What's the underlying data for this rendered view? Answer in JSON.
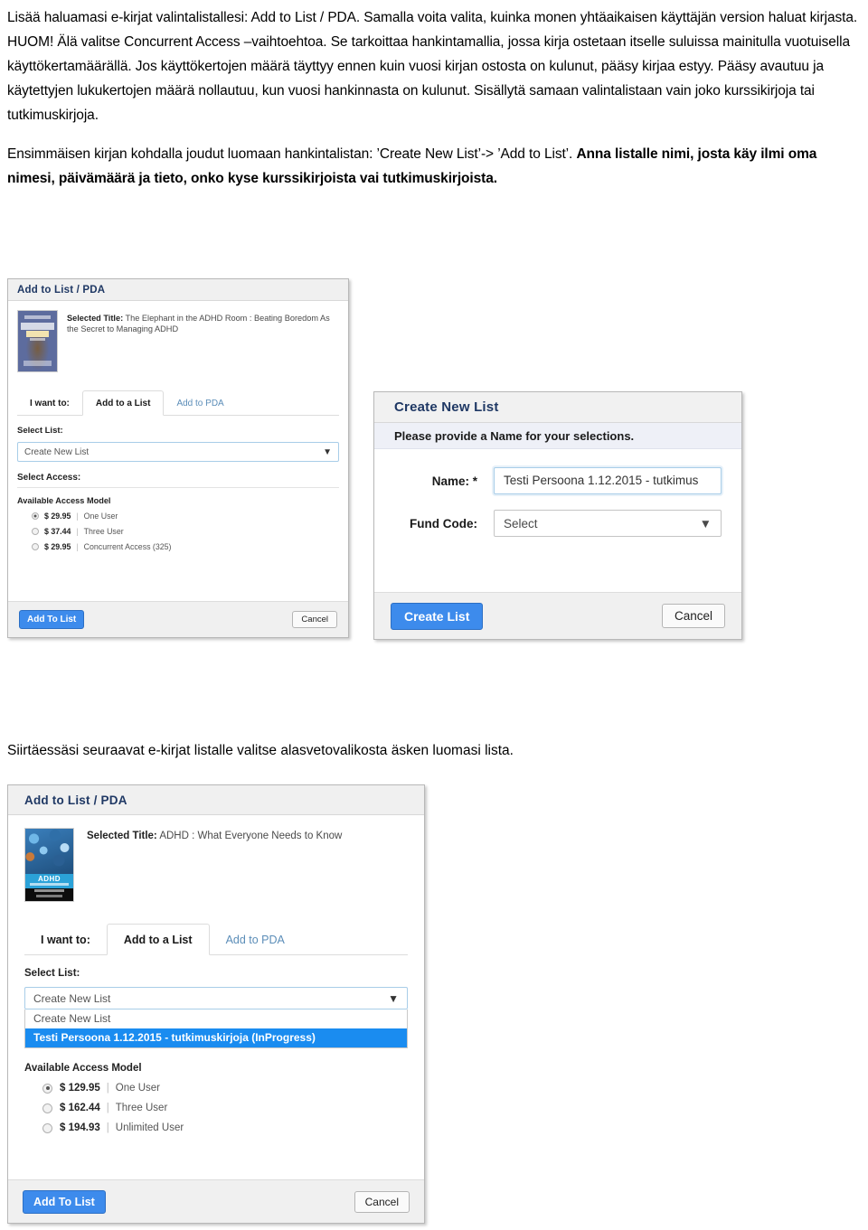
{
  "document": {
    "paragraph1": {
      "runs": [
        {
          "text": "Lisää haluamasi e-kirjat valintalistallesi: Add to List / PDA. Samalla voita valita, kuinka monen yhtäaikaisen käyttäjän version haluat kirjasta. HUOM! Älä valitse Concurrent Access –vaihtoehtoa. Se tarkoittaa hankintamallia, jossa kirja ostetaan itselle suluissa mainitulla vuotuisella käyttökertamäärällä. Jos käyttökertojen määrä täyttyy ennen kuin vuosi kirjan ostosta on kulunut, pääsy kirjaa estyy. Pääsy avautuu ja käytettyjen lukukertojen määrä nollautuu, kun vuosi hankinnasta on kulunut. Sisällytä samaan valintalistaan vain joko kurssikirjoja tai tutkimuskirjoja.",
          "bold": false
        }
      ]
    },
    "paragraph2": {
      "normal": "Ensimmäisen kirjan kohdalla joudut luomaan hankintalistan: ’Create New List’-> ’Add to List’. ",
      "bold": "Anna listalle nimi, josta käy ilmi oma nimesi, päivämäärä ja tieto, onko kyse kurssikirjoista vai tutkimuskirjoista."
    },
    "mid_caption": "Siirtäessäsi seuraavat e-kirjat listalle valitse alasvetovalikosta äsken luomasi lista."
  },
  "shot_a": {
    "header": "Add to List / PDA",
    "selected_title_label": "Selected Title:",
    "selected_title_value": " The Elephant in the ADHD Room : Beating Boredom As the Secret to Managing ADHD",
    "tabs": {
      "prompt": "I want to:",
      "active": "Add to a List",
      "inactive": "Add to PDA"
    },
    "select_list_label": "Select List:",
    "select_list_value": "Create New List",
    "caret": "▼",
    "select_access_label": "Select Access:",
    "available_access_model_label": "Available Access Model",
    "access_options": [
      {
        "price": "$ 29.95",
        "name": "One User",
        "selected": true
      },
      {
        "price": "$ 37.44",
        "name": "Three User",
        "selected": false
      },
      {
        "price": "$ 29.95",
        "name": "Concurrent Access (325)",
        "selected": false
      }
    ],
    "separator": "|",
    "primary_button": "Add To List",
    "secondary_button": "Cancel"
  },
  "shot_b": {
    "header": "Create New List",
    "instruction": "Please provide a Name for your selections.",
    "name_label": "Name: *",
    "name_value": "Testi Persoona 1.12.2015 - tutkimus",
    "fund_code_label": "Fund Code:",
    "fund_code_value": "Select",
    "caret": "▼",
    "primary_button": "Create List",
    "secondary_button": "Cancel"
  },
  "shot_c": {
    "header": "Add to List / PDA",
    "selected_title_label": "Selected Title:",
    "selected_title_value": " ADHD : What Everyone Needs to Know",
    "cover_text": "ADHD",
    "tabs": {
      "prompt": "I want to:",
      "active": "Add to a List",
      "inactive": "Add to PDA"
    },
    "select_list_label": "Select List:",
    "select_list_value": "Create New List",
    "caret": "▼",
    "dropdown_options": [
      {
        "label": "Create New List",
        "highlighted": false
      },
      {
        "label": "Testi Persoona 1.12.2015 - tutkimuskirjoja (InProgress)",
        "highlighted": true
      }
    ],
    "available_access_model_label": "Available Access Model",
    "access_options": [
      {
        "price": "$ 129.95",
        "name": "One User",
        "selected": true
      },
      {
        "price": "$ 162.44",
        "name": "Three User",
        "selected": false
      },
      {
        "price": "$ 194.93",
        "name": "Unlimited User",
        "selected": false
      }
    ],
    "separator": "|",
    "primary_button": "Add To List",
    "secondary_button": "Cancel"
  },
  "colors": {
    "accent_blue": "#3d8bec",
    "highlight_blue": "#1a8cf0",
    "header_bg": "#f0f0f0",
    "header_text": "#1f3864",
    "link_blue": "#5b8db8"
  }
}
